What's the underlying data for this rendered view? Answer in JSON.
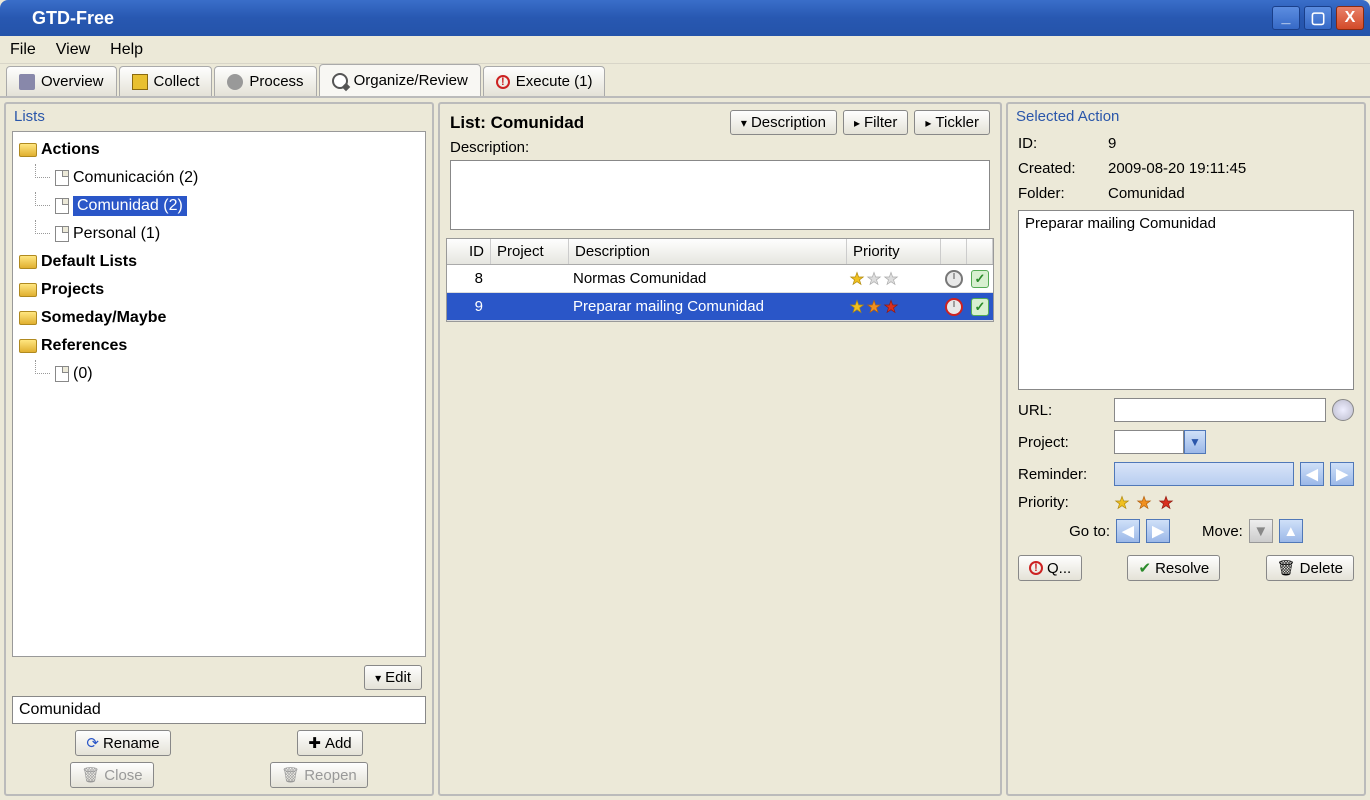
{
  "window": {
    "title": "GTD-Free"
  },
  "menu": {
    "file": "File",
    "view": "View",
    "help": "Help"
  },
  "tabs": {
    "overview": "Overview",
    "collect": "Collect",
    "process": "Process",
    "organize": "Organize/Review",
    "execute": "Execute (1)"
  },
  "lists": {
    "title": "Lists",
    "groups": {
      "actions": "Actions",
      "default": "Default Lists",
      "projects": "Projects",
      "someday": "Someday/Maybe",
      "references": "References"
    },
    "items": {
      "comunicacion": "Comunicación (2)",
      "comunidad": "Comunidad (2)",
      "personal": "Personal (1)",
      "ref0": "(0)"
    },
    "edit_btn": "Edit",
    "name_value": "Comunidad",
    "rename": "Rename",
    "add": "Add",
    "close": "Close",
    "reopen": "Reopen"
  },
  "center": {
    "list_label": "List: Comunidad",
    "btn_desc": "Description",
    "btn_filter": "Filter",
    "btn_tickler": "Tickler",
    "desc_label": "Description:",
    "cols": {
      "id": "ID",
      "project": "Project",
      "desc": "Description",
      "priority": "Priority"
    },
    "rows": [
      {
        "id": "8",
        "project": "",
        "desc": "Normas Comunidad",
        "stars": [
          "gold",
          "gray",
          "gray"
        ],
        "clock": "gray"
      },
      {
        "id": "9",
        "project": "",
        "desc": "Preparar mailing Comunidad",
        "stars": [
          "gold",
          "orange",
          "red"
        ],
        "clock": "red"
      }
    ]
  },
  "right": {
    "title": "Selected Action",
    "id_k": "ID:",
    "id_v": "9",
    "created_k": "Created:",
    "created_v": "2009-08-20 19:11:45",
    "folder_k": "Folder:",
    "folder_v": "Comunidad",
    "desc": "Preparar mailing Comunidad",
    "url_k": "URL:",
    "project_k": "Project:",
    "reminder_k": "Reminder:",
    "priority_k": "Priority:",
    "goto": "Go to:",
    "move": "Move:",
    "q": "Q...",
    "resolve": "Resolve",
    "delete": "Delete"
  }
}
